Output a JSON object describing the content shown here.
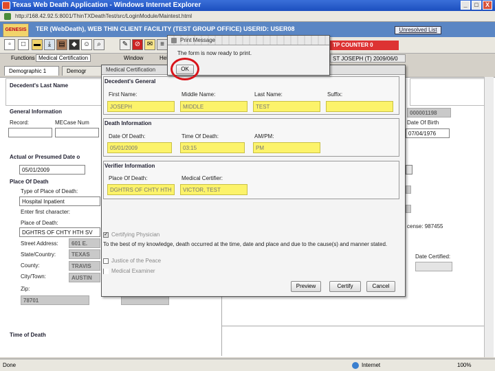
{
  "window": {
    "title": "Texas Web Death Application - Windows Internet Explorer",
    "minimize": "_",
    "maximize": "□",
    "close": "X",
    "address": "http://168.42.92.5:8001/ThinTXDeathTest/src/LoginModule/Maintest.html"
  },
  "app": {
    "logo": "GENESIS",
    "header": "TER (WebDeath), WEB THIN CLIENT FACILITY (TEST GROUP OFFICE) USERID: USER08",
    "unresolved_link": "Unresolved List",
    "counter": "TP COUNTER 0",
    "record_info": "ST JOSEPH (T) 2009/06/0"
  },
  "menu": {
    "functions": "Functions",
    "medical_cert": "Medical Certification",
    "window": "Window",
    "help": "Hel"
  },
  "tabs": [
    "Demographic 1",
    "Demogr"
  ],
  "background": {
    "decedent_last_name_label": "Decedent's Last Name",
    "general_info_label": "General Information",
    "record_label": "Record:",
    "mefcase_label": "MECase Num",
    "record_number": "000001198",
    "date_of_birth_label": "Date Of Birth",
    "date_of_birth": "07/04/1976",
    "actual_date_label": "Actual or Presumed Date o",
    "actual_date": "05/01/2009",
    "place_of_death_label": "Place Of Death",
    "type_place_label": "Type of Place of Death:",
    "type_place_value": "Hospital  Inpatient",
    "enter_first_char": "Enter first character:",
    "place_death_label2": "Place of Death:",
    "place_death_value": "DGHTRS OF CHTY HTH SV",
    "street_label": "Street Address:",
    "street_value": "601 E.",
    "state_label": "State/Country:",
    "state_value": "TEXAS",
    "county_label": "County:",
    "county_value": "TRAVIS",
    "city_label": "City/Town:",
    "city_value": "AUSTIN",
    "zip_label": "Zip:",
    "zip_value": "78701",
    "license_text": "cense: 987455",
    "date_certified_label": "Date Certified:",
    "time_of_death_label": "Time of Death"
  },
  "med_dialog": {
    "title": "Medical Certification",
    "decedent_group": "Decedent's General",
    "first_name_label": "First Name:",
    "middle_name_label": "Middle Name:",
    "last_name_label": "Last Name:",
    "suffix_label": "Suffix:",
    "first_name": "JOSEPH",
    "middle_name": "MIDDLE",
    "last_name": "TEST",
    "suffix": "",
    "death_group": "Death Information",
    "date_of_death_label": "Date Of Death:",
    "time_of_death_label": "Time Of Death:",
    "ampm_label": "AM/PM:",
    "date_of_death": "05/01/2009",
    "time_of_death": "03:15",
    "ampm": "PM",
    "verifier_group": "Verifier Information",
    "place_of_death_label": "Place Of Death:",
    "med_cert_label": "Medical Certifier:",
    "place_of_death": "DGHTRS OF CHTY HTH",
    "med_certifier": "VICTOR, TEST",
    "certifying_physician": "Certifying Physician",
    "statement": "To the best of my knowledge, death occurred at the time, date and place and due to the cause(s) and manner stated.",
    "justice_of_peace": "Justice of the Peace",
    "medical_examiner": "Medical Examiner",
    "preview": "Preview",
    "certify": "Certify",
    "cancel": "Cancel"
  },
  "print_dialog": {
    "title": "Print Message",
    "message": "The form is now ready to print.",
    "ok": "OK"
  },
  "status": {
    "done": "Done",
    "zone": "Internet",
    "zoom": "100%"
  }
}
